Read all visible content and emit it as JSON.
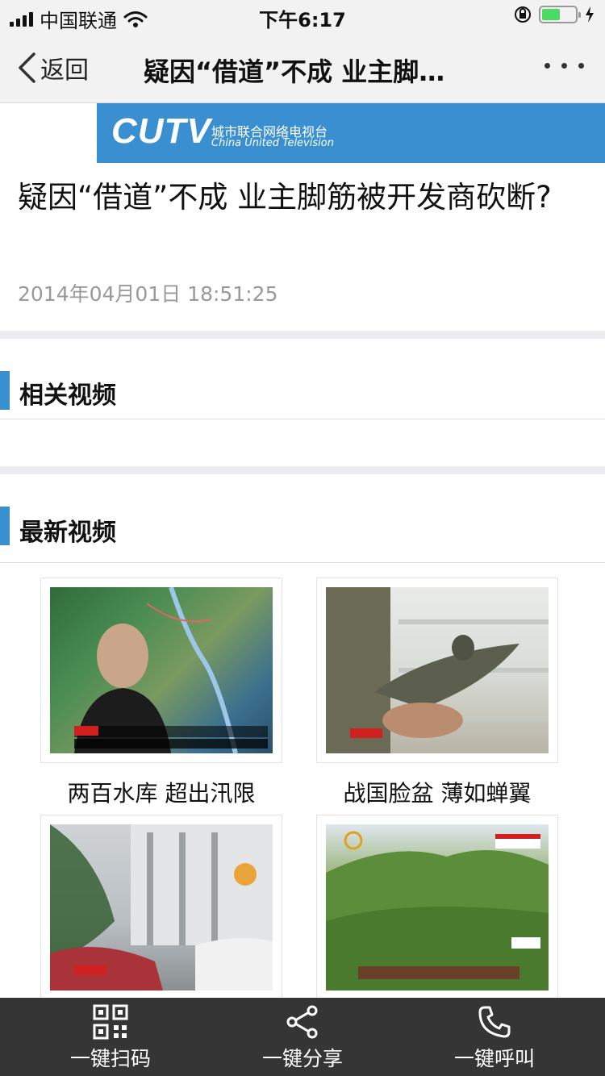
{
  "status_bar": {
    "carrier": "中国联通",
    "time": "下午6:17"
  },
  "nav": {
    "back_label": "返回",
    "title": "疑因“借道”不成 业主脚…"
  },
  "banner": {
    "brand": "CUTV",
    "brand_cn": "城市联合网络电视台",
    "brand_en": "China United Television"
  },
  "article": {
    "headline": "疑因“借道”不成 业主脚筋被开发商砍断?",
    "date": "2014年04月01日  18:51:25"
  },
  "sections": {
    "related": "相关视频",
    "latest": "最新视频"
  },
  "videos": [
    {
      "caption": "两百水库 超出汛限"
    },
    {
      "caption": "战国脸盆 薄如蝉翼"
    },
    {
      "caption": ""
    },
    {
      "caption": ""
    }
  ],
  "tabbar": {
    "items": [
      {
        "label": "一键扫码",
        "icon": "qr-code-icon"
      },
      {
        "label": "一键分享",
        "icon": "share-icon"
      },
      {
        "label": "一键呼叫",
        "icon": "phone-icon"
      }
    ]
  },
  "colors": {
    "accent": "#3a8fd0",
    "tabbar_bg": "#353535",
    "battery": "#4cd964"
  }
}
